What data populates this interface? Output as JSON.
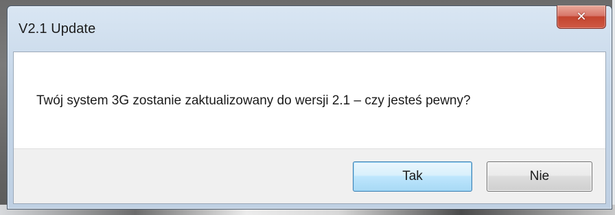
{
  "window": {
    "title": "V2.1 Update",
    "close_icon": "close-icon"
  },
  "dialog": {
    "message": "Twój system 3G zostanie zaktualizowany do wersji 2.1 – czy jesteś pewny?"
  },
  "buttons": {
    "yes_label": "Tak",
    "no_label": "Nie"
  },
  "colors": {
    "close_button": "#c3442f",
    "default_button_border": "#3c7fb1",
    "footer_background": "#f0f0f0"
  }
}
